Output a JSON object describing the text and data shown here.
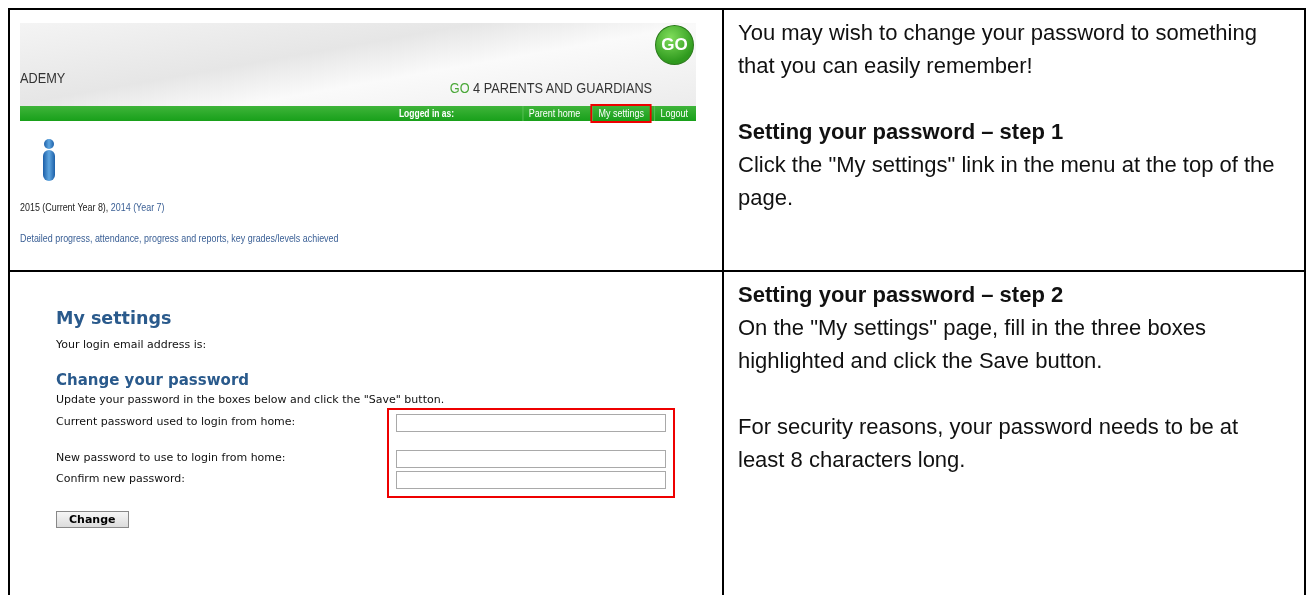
{
  "step1_screenshot": {
    "school_name_fragment": "ADEMY",
    "brand_prefix": "GO",
    "brand_suffix": "4 PARENTS AND GUARDIANS",
    "logo": "GO",
    "logged_in_label": "Logged in as:",
    "menu": [
      {
        "label": "Parent home",
        "highlighted": false
      },
      {
        "label": "My settings",
        "highlighted": true
      },
      {
        "label": "Logout",
        "highlighted": false
      }
    ],
    "years": [
      {
        "text": "2015 (Current Year 8),",
        "link": false
      },
      {
        "text": "2014 (Year 7)",
        "link": true
      }
    ],
    "details_link": "Detailed progress, attendance, progress and reports, key grades/levels achieved"
  },
  "step1_text": {
    "intro": "You may wish to change your password to something that you can easily remember!",
    "heading": "Setting your password – step 1",
    "body": "Click the \"My settings\" link in the menu at the top of the page."
  },
  "step2_screenshot": {
    "title": "My settings",
    "email_label": "Your login email address is:",
    "section_title": "Change your password",
    "instructions": "Update your password in the boxes below and click the \"Save\" button.",
    "fields_highlighted": true,
    "fields": [
      {
        "label": "Current password used to login from home:"
      },
      {
        "label": "New password to use to login from home:"
      },
      {
        "label": "Confirm new password:"
      }
    ],
    "button": "Change"
  },
  "step2_text": {
    "heading": "Setting your password – step 2",
    "paragraphs": [
      "On the \"My settings\" page, fill in the three boxes highlighted and click the Save button.",
      "For security reasons, your password needs to be at least 8 characters long."
    ]
  }
}
